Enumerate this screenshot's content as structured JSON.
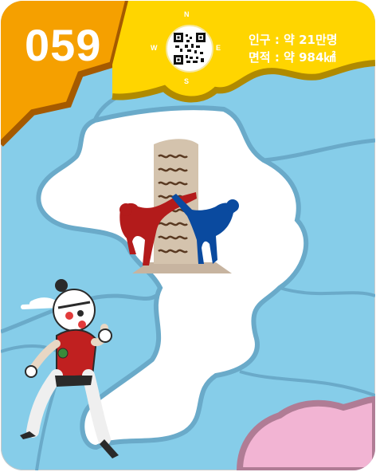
{
  "region": {
    "number": "059",
    "population_label": "인구 : 약 21만명",
    "area_label": "면적 : 약 984㎢"
  },
  "compass": {
    "north": "N",
    "south": "S",
    "east": "E",
    "west": "W"
  },
  "icons": {
    "qr": "qr-code-icon",
    "monument": "stone-monument-icon",
    "kickers": "taekwondo-kick-figures-icon",
    "mascot": "fighting-mascot-character"
  },
  "colors": {
    "sea": "#86cde9",
    "map_land": "#ffffff",
    "map_border": "#6aaac9",
    "badge_orange": "#f5a000",
    "badge_yellow": "#ffd500",
    "bottom_pink": "#f2b4d3",
    "kick_red": "#b31b1b",
    "kick_blue": "#0a4a9f"
  }
}
